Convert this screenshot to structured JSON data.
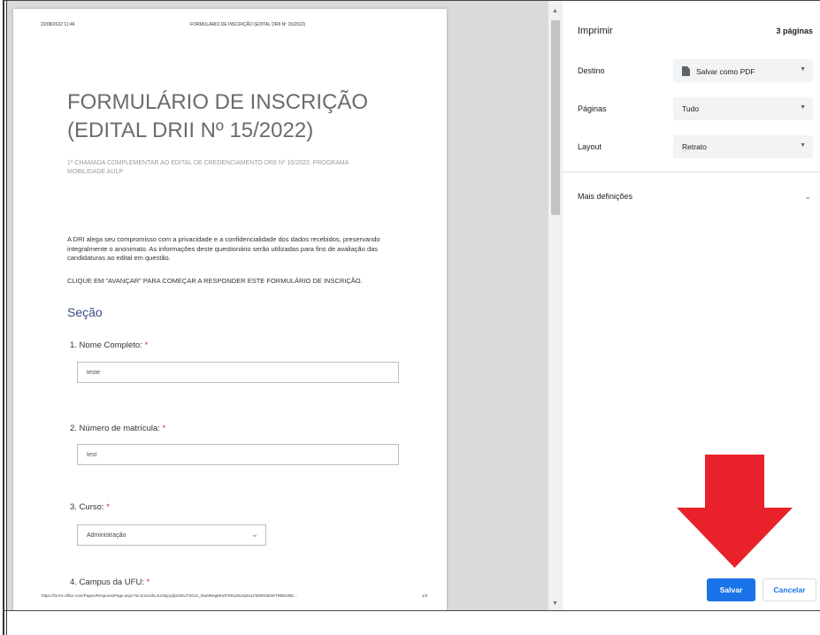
{
  "preview": {
    "header_date": "22/08/2022 11:46",
    "header_title": "FORMULÁRIO DE INSCRIÇÃO (EDITAL DRII Nº 15/2022)",
    "form_title_line1": "FORMULÁRIO DE INSCRIÇÃO",
    "form_title_line2": "(EDITAL DRII Nº 15/2022)",
    "form_subtitle": "1ª CHAMADA COMPLEMENTAR AO EDITAL DE CREDENCIAMENTO DRII Nº 10/2022: PROGRAMA MOBILIDADE AULP",
    "intro_text": "A DRI alega seu compromisso com a privacidade e a confidencialidade dos dados recebidos, preservando integralmente o anonimato. As informações deste questionário serão utilizadas para fins de avaliação das candidaturas ao edital em questão.",
    "cta_text": "CLIQUE EM \"AVANÇAR\" PARA COMEÇAR A RESPONDER ESTE FORMULÁRIO DE INSCRIÇÃO.",
    "section_title": "Seção",
    "questions": [
      {
        "label": "1. Nome Completo:",
        "required": "*",
        "value": "teste"
      },
      {
        "label": "2. Número de matrícula:",
        "required": "*",
        "value": "test"
      },
      {
        "label": "3. Curso:",
        "required": "*",
        "value": "Administração"
      },
      {
        "label": "4. Campus da UFU:",
        "required": "*",
        "value": ""
      }
    ],
    "footer_url": "https://forms.office.com/Pages/ResponsePage.aspx?id=D1es2hLJUGkjoy2jlaOEUTXOJc_MuMNegMHdTRRuZ5UQEsLFBWR0k0WTRBNVBE...",
    "footer_page": "1/3"
  },
  "panel": {
    "title": "Imprimir",
    "page_count": "3 páginas",
    "destination_label": "Destino",
    "destination_value": "Salvar como PDF",
    "pages_label": "Páginas",
    "pages_value": "Tudo",
    "layout_label": "Layout",
    "layout_value": "Retrato",
    "more_settings": "Mais definições",
    "save_button": "Salvar",
    "cancel_button": "Cancelar"
  },
  "icons": {
    "destination": "document-icon",
    "dropdown": "chevron-down-icon",
    "annotation": "red-arrow-down-icon"
  },
  "colors": {
    "accent": "#1a73e8",
    "annotation_arrow": "#e8212b",
    "section_title": "#3b4a86",
    "required": "#c4314b"
  }
}
